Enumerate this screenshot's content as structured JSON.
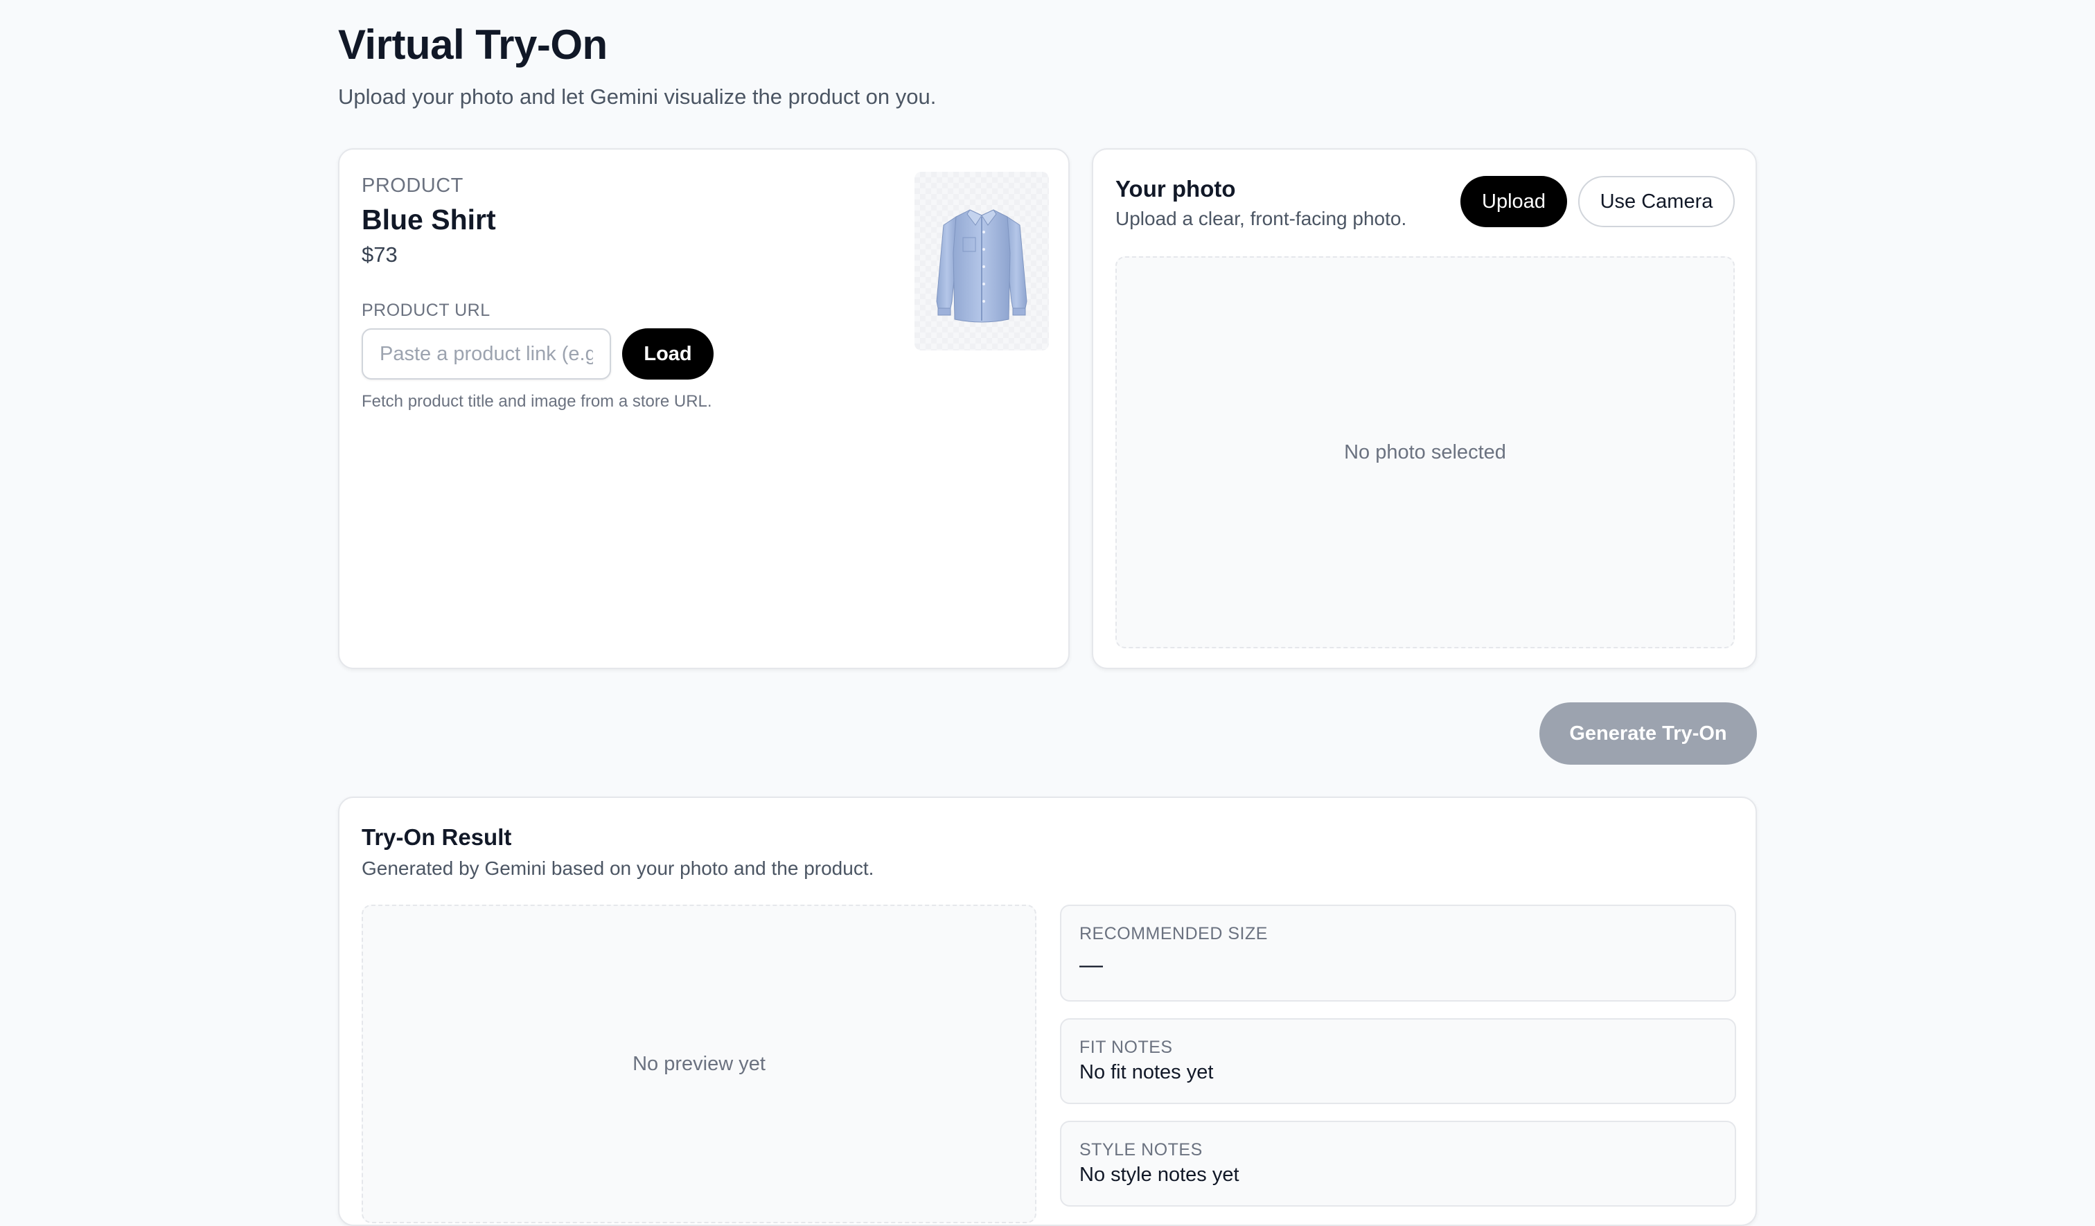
{
  "header": {
    "title": "Virtual Try-On",
    "subtitle": "Upload your photo and let Gemini visualize the product on you."
  },
  "product": {
    "section_label": "PRODUCT",
    "name": "Blue Shirt",
    "price": "$73",
    "url_label": "PRODUCT URL",
    "url_placeholder": "Paste a product link (e.g.",
    "url_value": "",
    "load_label": "Load",
    "help_text": "Fetch product title and image from a store URL.",
    "image_icon": "shirt-icon"
  },
  "photo": {
    "title": "Your photo",
    "subtitle": "Upload a clear, front-facing photo.",
    "upload_label": "Upload",
    "camera_label": "Use Camera",
    "empty_text": "No photo selected"
  },
  "actions": {
    "generate_label": "Generate Try-On",
    "generate_disabled": true
  },
  "result": {
    "title": "Try-On Result",
    "subtitle": "Generated by Gemini based on your photo and the product.",
    "preview_empty": "No preview yet",
    "recommended_size_label": "RECOMMENDED SIZE",
    "recommended_size_value": "—",
    "fit_notes_label": "FIT NOTES",
    "fit_notes_value": "No fit notes yet",
    "style_notes_label": "STYLE NOTES",
    "style_notes_value": "No style notes yet"
  },
  "colors": {
    "primary_button": "#000000",
    "disabled_button": "#9ca3af",
    "page_background": "#f8fafc",
    "shirt_blue": "#a9bde0"
  }
}
